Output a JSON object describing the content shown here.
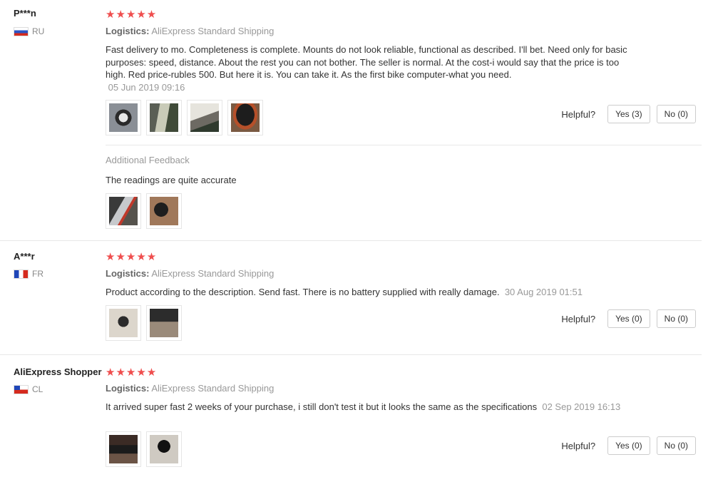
{
  "reviews": [
    {
      "user": "P***n",
      "country": "RU",
      "stars": "★★★★★",
      "logistics_label": "Logistics:",
      "logistics_value": "AliExpress Standard Shipping",
      "text": "Fast delivery to mo. Completeness is complete. Mounts do not look reliable, functional as described. I'll bet. Need only for basic purposes: speed, distance. About the rest you can not bother. The seller is normal. At the cost-i would say that the price is too high. Red price-rubles 500. But here it is. You can take it. As the first bike computer-what you need.",
      "date": "05 Jun 2019 09:16",
      "helpful_label": "Helpful?",
      "yes_label": "Yes (3)",
      "no_label": "No (0)",
      "additional": {
        "title": "Additional Feedback",
        "text": "The readings are quite accurate"
      }
    },
    {
      "user": "A***r",
      "country": "FR",
      "stars": "★★★★★",
      "logistics_label": "Logistics:",
      "logistics_value": "AliExpress Standard Shipping",
      "text": "Product according to the description. Send fast. There is no battery supplied with really damage.",
      "date": "30 Aug 2019 01:51",
      "helpful_label": "Helpful?",
      "yes_label": "Yes (0)",
      "no_label": "No (0)"
    },
    {
      "user": "AliExpress Shopper",
      "country": "CL",
      "stars": "★★★★★",
      "logistics_label": "Logistics:",
      "logistics_value": "AliExpress Standard Shipping",
      "text": "It arrived super fast 2 weeks of your purchase, i still don't test it but it looks the same as the specifications",
      "date": "02 Sep 2019 16:13",
      "helpful_label": "Helpful?",
      "yes_label": "Yes (0)",
      "no_label": "No (0)"
    }
  ],
  "colors": {
    "star": "#ef4e4e",
    "muted": "#999999",
    "text": "#333333"
  }
}
